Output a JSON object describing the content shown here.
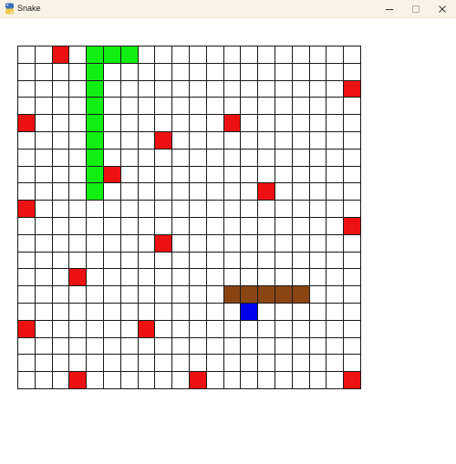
{
  "window": {
    "title": "Snake",
    "app_icon": "python-icon",
    "controls": {
      "minimize_icon": "minimize-icon",
      "maximize_icon": "maximize-icon",
      "close_icon": "close-icon"
    }
  },
  "board": {
    "rows": 20,
    "cols": 20,
    "colors": {
      "empty": "#ffffff",
      "grid_line": "#1a1a1a",
      "food": "#ee1111",
      "snake_player": "#11ee11",
      "snake_enemy": "#8b4513",
      "enemy_head": "#0000ee"
    },
    "food": [
      [
        0,
        2
      ],
      [
        2,
        19
      ],
      [
        4,
        0
      ],
      [
        4,
        12
      ],
      [
        5,
        8
      ],
      [
        7,
        5
      ],
      [
        8,
        14
      ],
      [
        9,
        0
      ],
      [
        10,
        19
      ],
      [
        11,
        8
      ],
      [
        13,
        3
      ],
      [
        16,
        0
      ],
      [
        16,
        7
      ],
      [
        19,
        3
      ],
      [
        19,
        10
      ],
      [
        19,
        19
      ]
    ],
    "player_snake": [
      [
        0,
        4
      ],
      [
        0,
        5
      ],
      [
        0,
        6
      ],
      [
        1,
        4
      ],
      [
        2,
        4
      ],
      [
        3,
        4
      ],
      [
        4,
        4
      ],
      [
        5,
        4
      ],
      [
        6,
        4
      ],
      [
        7,
        4
      ],
      [
        8,
        4
      ]
    ],
    "enemy_snake": [
      [
        14,
        12
      ],
      [
        14,
        13
      ],
      [
        14,
        14
      ],
      [
        14,
        15
      ],
      [
        14,
        16
      ]
    ],
    "enemy_head": [
      15,
      13
    ]
  }
}
